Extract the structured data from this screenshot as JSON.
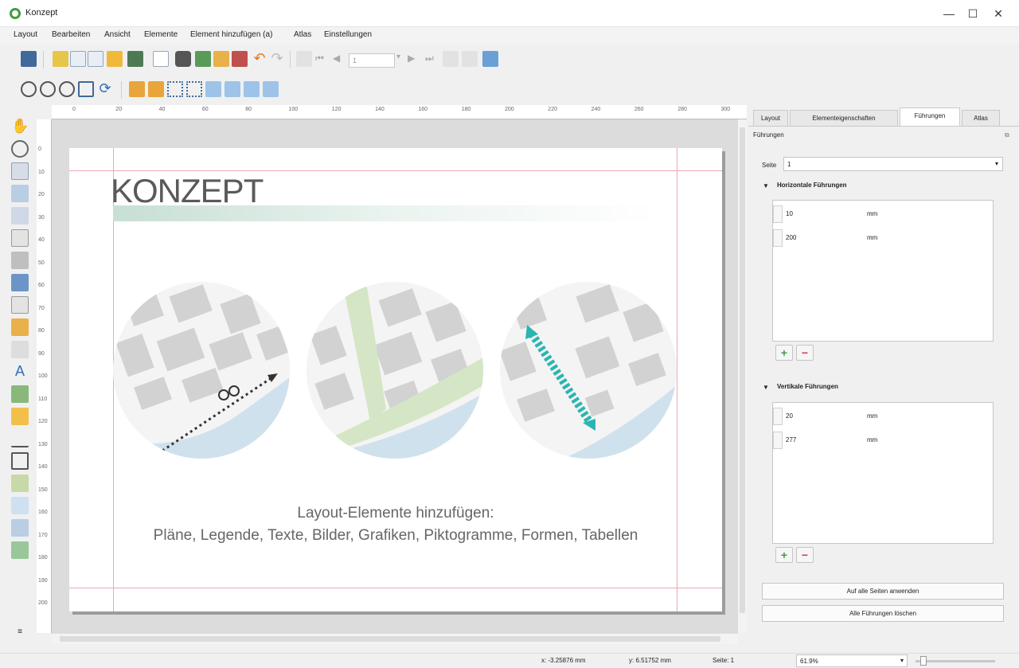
{
  "window": {
    "title": "Konzept",
    "minimize": "—",
    "maximize": "☐",
    "close": "✕"
  },
  "menu": [
    "Layout",
    "Bearbeiten",
    "Ansicht",
    "Elemente",
    "Element hinzufügen (a)",
    "Atlas",
    "Einstellungen"
  ],
  "toolbar": {
    "atlas_page_value": "1"
  },
  "canvas": {
    "title": "KONZEPT",
    "caption_line1": "Layout-Elemente hinzufügen:",
    "caption_line2": "Pläne, Legende, Texte, Bilder, Grafiken, Piktogramme, Formen, Tabellen"
  },
  "ruler_top_labels": [
    "0",
    "20",
    "40",
    "60",
    "80",
    "100",
    "120",
    "140",
    "160",
    "180",
    "200",
    "220",
    "240",
    "260",
    "280",
    "300"
  ],
  "ruler_left_labels": [
    "0",
    "10",
    "20",
    "30",
    "40",
    "50",
    "60",
    "70",
    "80",
    "90",
    "100",
    "110",
    "120",
    "130",
    "140",
    "150",
    "160",
    "170",
    "180",
    "190",
    "200"
  ],
  "panel": {
    "tabs": [
      "Layout",
      "Elementeigenschaften",
      "Führungen",
      "Atlas"
    ],
    "active_tab": "Führungen",
    "dock_title": "Führungen",
    "page_label": "Seite",
    "page_value": "1",
    "horizontal_section": "Horizontale Führungen",
    "horizontal_guides": [
      {
        "value": "10",
        "unit": "mm"
      },
      {
        "value": "200",
        "unit": "mm"
      }
    ],
    "vertical_section": "Vertikale Führungen",
    "vertical_guides": [
      {
        "value": "20",
        "unit": "mm"
      },
      {
        "value": "277",
        "unit": "mm"
      }
    ],
    "add_symbol": "+",
    "remove_symbol": "−",
    "apply_all_pages": "Auf alle Seiten anwenden",
    "delete_all": "Alle Führungen löschen"
  },
  "status": {
    "x": "x: -3.25876 mm",
    "y": "y: 6.51752 mm",
    "page": "Seite: 1",
    "zoom": "61.9%"
  },
  "colors": {
    "accent_green": "#3f9e3f",
    "guide": "#f0a6b0",
    "teal_path": "#2bb5b0",
    "water": "#cfe1ec",
    "park": "#d4e6c5"
  }
}
